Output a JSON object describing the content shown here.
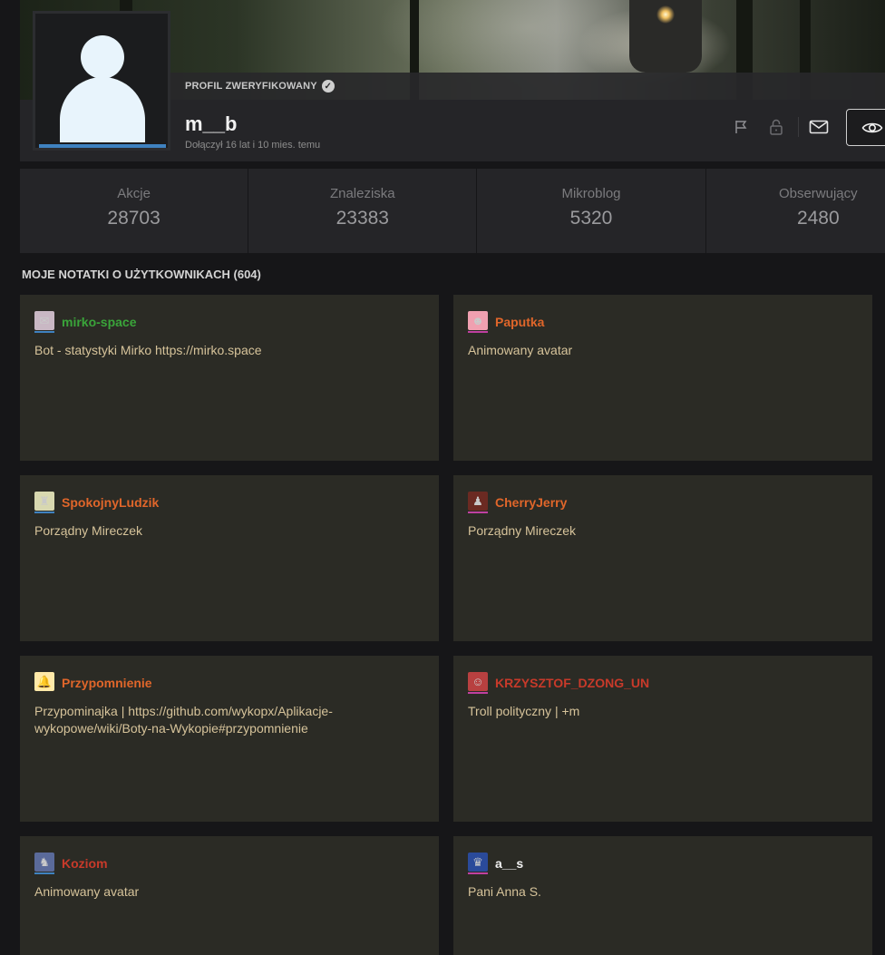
{
  "profile": {
    "verified_label": "PROFIL ZWERYFIKOWANY",
    "username": "m__b",
    "joined": "Dołączył 16 lat i 10 mies. temu"
  },
  "icons": {
    "verified": "check-circle-icon",
    "report": "flag-icon",
    "block": "lock-icon",
    "message": "mail-icon",
    "observe": "eye-icon"
  },
  "stats": [
    {
      "label": "Akcje",
      "value": "28703"
    },
    {
      "label": "Znaleziska",
      "value": "23383"
    },
    {
      "label": "Mikroblog",
      "value": "5320"
    },
    {
      "label": "Obserwujący",
      "value": "2480"
    }
  ],
  "notes": {
    "title": "MOJE NOTATKI O UŻYTKOWNIKACH (604)",
    "items": [
      {
        "nick": "mirko-space",
        "text": "Bot - statystyki Mirko https://mirko.space",
        "nick_color": "#3aa43a",
        "avatar_bg": "#c9b8c4",
        "bar_color": "#3f82c0",
        "avatar_glyph": "✉"
      },
      {
        "nick": "Paputka",
        "text": "Animowany avatar",
        "nick_color": "#e0662a",
        "avatar_bg": "#f0a0b0",
        "bar_color": "#c040a0",
        "avatar_glyph": "☻"
      },
      {
        "nick": "SpokojnyLudzik",
        "text": "Porządny Mireczek",
        "nick_color": "#e0662a",
        "avatar_bg": "#d8d8b0",
        "bar_color": "#3f82c0",
        "avatar_glyph": "♜"
      },
      {
        "nick": "CherryJerry",
        "text": "Porządny Mireczek",
        "nick_color": "#e0662a",
        "avatar_bg": "#6b2a22",
        "bar_color": "#c040a0",
        "avatar_glyph": "♟"
      },
      {
        "nick": "Przypomnienie",
        "text": "Przypominajka | https://github.com/wykopx/Aplikacje-wykopowe/wiki/Boty-na-Wykopie#przypomnienie",
        "nick_color": "#e0662a",
        "avatar_bg": "#ffe9a8",
        "bar_color": "#2b2b25",
        "avatar_glyph": "🔔"
      },
      {
        "nick": "KRZYSZTOF_DZONG_UN",
        "text": "Troll polityczny | +m",
        "nick_color": "#c83a2a",
        "avatar_bg": "#b84040",
        "bar_color": "#c040a0",
        "avatar_glyph": "☺"
      },
      {
        "nick": "Koziom",
        "text": "Animowany avatar",
        "nick_color": "#c83a2a",
        "avatar_bg": "#5a6a9a",
        "bar_color": "#3f82c0",
        "avatar_glyph": "♞"
      },
      {
        "nick": "a__s",
        "text": "Pani Anna S.",
        "nick_color": "#f2f2f2",
        "avatar_bg": "#2a4a9a",
        "bar_color": "#c040a0",
        "avatar_glyph": "♛"
      }
    ]
  }
}
